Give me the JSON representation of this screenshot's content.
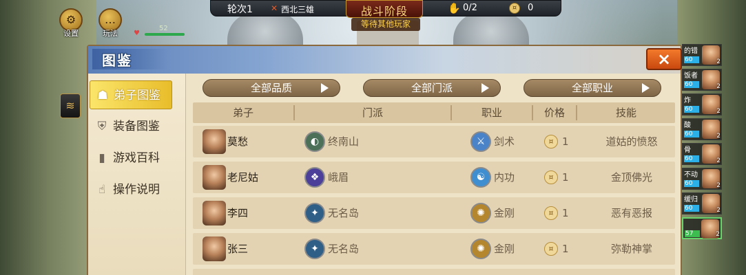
{
  "hud": {
    "round_label": "轮次1",
    "map_name": "西北三雄",
    "phase_title": "战斗阶段",
    "phase_status": "等待其他玩家",
    "loot_count": "0/2",
    "coin_count": "0",
    "hp_value": "52"
  },
  "top_buttons": [
    {
      "label": "设置",
      "icon": "gear-icon"
    },
    {
      "label": "玩法",
      "icon": "chat-bubble-icon"
    }
  ],
  "players": [
    {
      "name": "的错",
      "level": "2",
      "bar": "60"
    },
    {
      "name": "饭者",
      "level": "2",
      "bar": "60"
    },
    {
      "name": "炸",
      "level": "2",
      "bar": "60"
    },
    {
      "name": "酸",
      "level": "2",
      "bar": "60"
    },
    {
      "name": "骨",
      "level": "2",
      "bar": "60"
    },
    {
      "name": "不动",
      "level": "2",
      "bar": "60"
    },
    {
      "name": "缓归",
      "level": "2",
      "bar": "60"
    },
    {
      "name": "",
      "level": "2",
      "bar": "57"
    }
  ],
  "panel": {
    "title": "图鉴",
    "close_label": "×",
    "sidebar": [
      {
        "label": "弟子图鉴",
        "icon": "disciple-icon",
        "active": true
      },
      {
        "label": "装备图鉴",
        "icon": "equipment-icon",
        "active": false
      },
      {
        "label": "游戏百科",
        "icon": "book-icon",
        "active": false
      },
      {
        "label": "操作说明",
        "icon": "hand-pointer-icon",
        "active": false
      }
    ],
    "filters": [
      "全部品质",
      "全部门派",
      "全部职业"
    ],
    "columns": [
      "弟子",
      "门派",
      "职业",
      "价格",
      "技能"
    ],
    "rows": [
      {
        "name": "莫愁",
        "sect": "终南山",
        "sect_color": "#4d7058",
        "job": "剑术",
        "job_color": "#4b83c9",
        "price": "1",
        "skill": "道姑的愤怒"
      },
      {
        "name": "老尼姑",
        "sect": "峨眉",
        "sect_color": "#4b3f9a",
        "job": "内功",
        "job_color": "#3f8fd0",
        "price": "1",
        "skill": "金顶佛光"
      },
      {
        "name": "李四",
        "sect": "无名岛",
        "sect_color": "#2f5e86",
        "job": "金刚",
        "job_color": "#b4862e",
        "price": "1",
        "skill": "恶有恶报"
      },
      {
        "name": "张三",
        "sect": "无名岛",
        "sect_color": "#2f5e86",
        "job": "金刚",
        "job_color": "#b4862e",
        "price": "1",
        "skill": "弥勒神掌"
      }
    ]
  }
}
